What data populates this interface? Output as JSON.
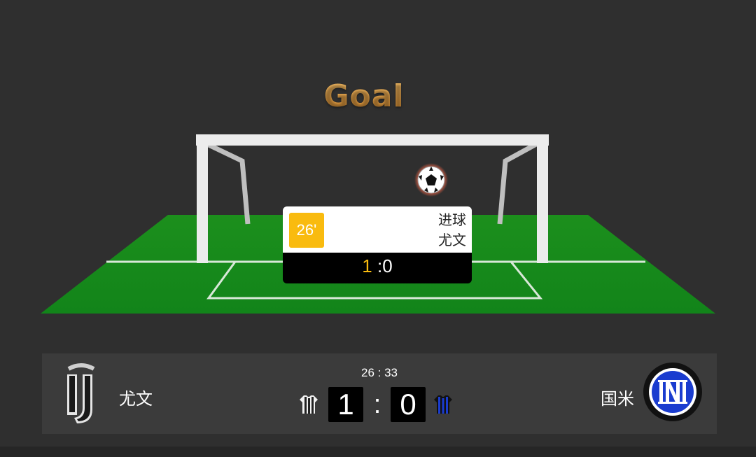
{
  "animation": {
    "title": "Goal"
  },
  "event": {
    "minute": "26'",
    "type": "进球",
    "team": "尤文",
    "score_home": "1",
    "score_sep_away": " :0"
  },
  "match": {
    "clock": "26 : 33",
    "home": {
      "name": "尤文",
      "score": "1",
      "logo_icon": "juventus-logo",
      "jersey_icon": "black-white-striped-jersey"
    },
    "away": {
      "name": "国米",
      "score": "0",
      "logo_icon": "inter-logo",
      "jersey_icon": "black-blue-striped-jersey"
    },
    "separator": ":"
  },
  "colors": {
    "background": "#2f2f2f",
    "pitch": "#1f8a1f",
    "accent": "#f9bb0f",
    "title_gradient_top": "#f6c06a",
    "title_gradient_bottom": "#d98b2c",
    "inter_blue": "#1a3ccf"
  }
}
